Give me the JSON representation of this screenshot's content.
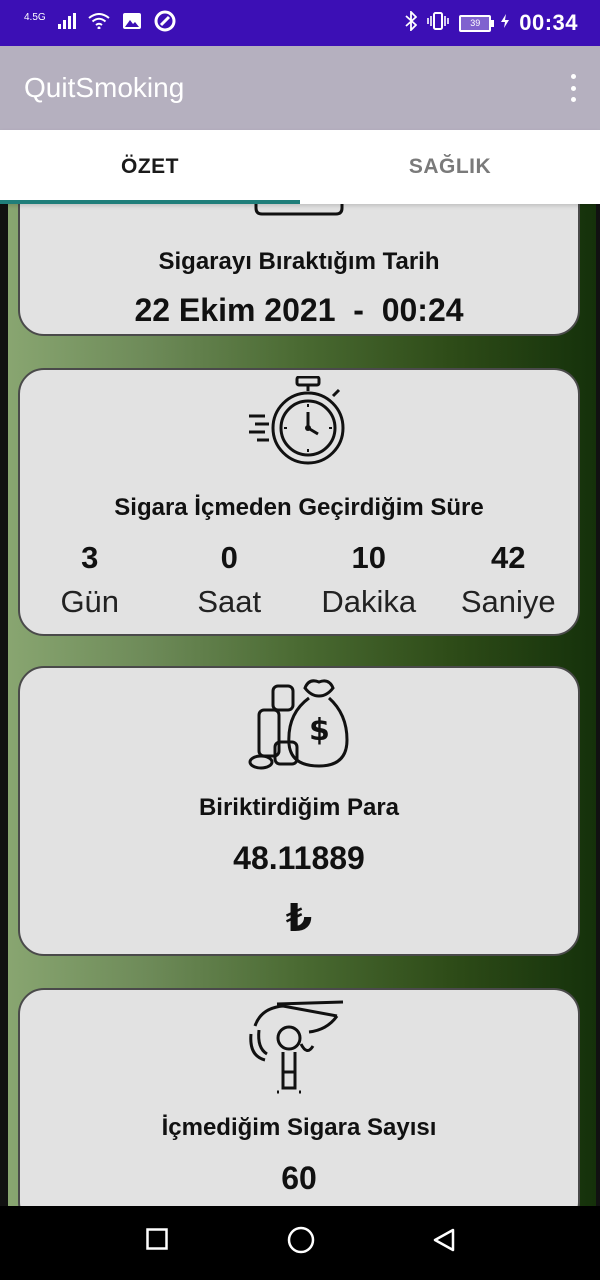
{
  "status": {
    "network": "4.5G",
    "battery": "39",
    "time": "00:34"
  },
  "app": {
    "title": "QuitSmoking"
  },
  "tabs": [
    {
      "label": "ÖZET"
    },
    {
      "label": "SAĞLIK"
    }
  ],
  "quit_date": {
    "label": "Sigarayı Bıraktığım Tarih",
    "date": "22 Ekim 2021",
    "separator": "-",
    "time": "00:24"
  },
  "duration": {
    "label": "Sigara İçmeden Geçirdiğim Süre",
    "items": [
      {
        "value": "3",
        "unit": "Gün"
      },
      {
        "value": "0",
        "unit": "Saat"
      },
      {
        "value": "10",
        "unit": "Dakika"
      },
      {
        "value": "42",
        "unit": "Saniye"
      }
    ]
  },
  "money": {
    "label": "Biriktirdiğim Para",
    "value": "48.11889",
    "currency": "₺"
  },
  "cigarettes": {
    "label": "İçmediğim Sigara Sayısı",
    "value": "60"
  },
  "icons": [
    "calendar-icon",
    "stopwatch-icon",
    "money-bag-icon",
    "hand-cigarette-icon"
  ]
}
